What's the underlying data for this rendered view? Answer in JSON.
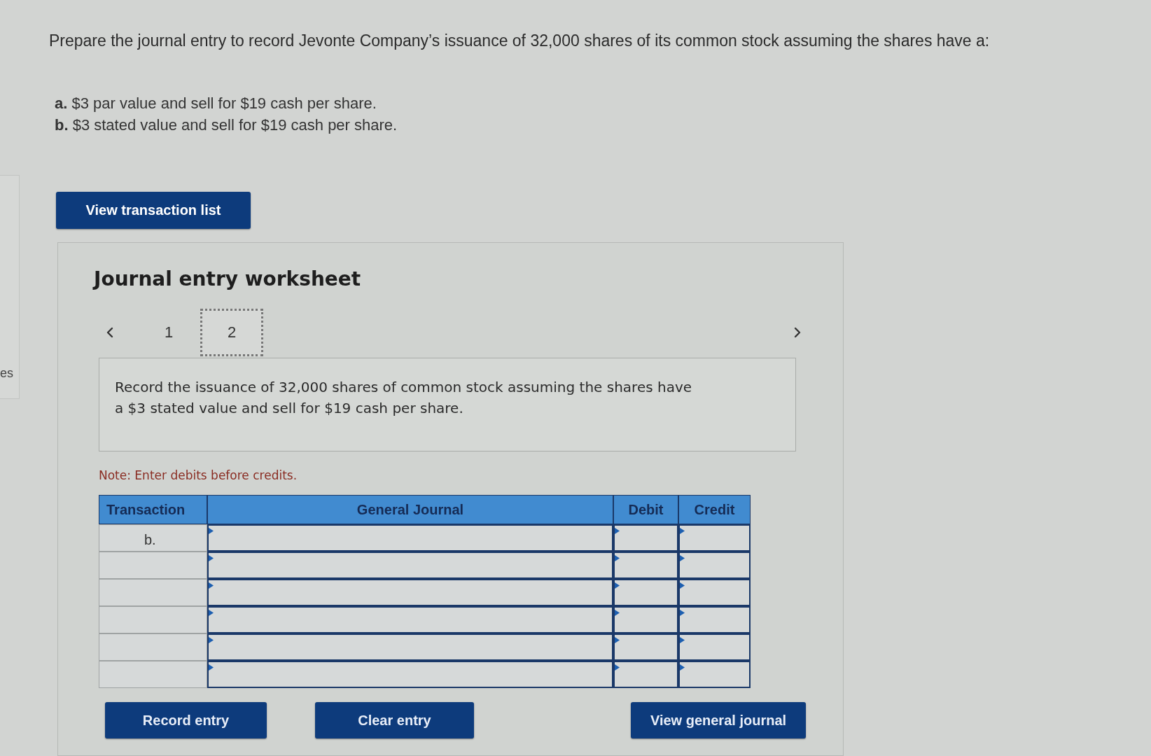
{
  "side_label": "es",
  "question": {
    "text": "Prepare the journal entry to record Jevonte Company’s issuance of 32,000 shares of its common stock assuming the shares have a:",
    "parts": [
      "**a.** $3 par value and sell for $19 cash per share.",
      "**b.** $3 stated value and sell for $19 cash per share."
    ]
  },
  "transaction_list_button": "View transaction list",
  "worksheet": {
    "title": "Journal entry worksheet",
    "pages": [
      {
        "label": "1",
        "selected": false
      },
      {
        "label": "2",
        "selected": true
      }
    ],
    "instruction": "Record the issuance of 32,000 shares of common stock assuming the shares have a $3 stated value and sell for $19 cash per share.",
    "note": "Note: Enter debits before credits.",
    "table": {
      "columns": [
        "Transaction",
        "General Journal",
        "Debit",
        "Credit"
      ],
      "rows": [
        {
          "transaction": "b."
        },
        {},
        {},
        {},
        {},
        {}
      ]
    },
    "buttons": [
      "Record entry",
      "Clear entry",
      "View general journal"
    ]
  }
}
